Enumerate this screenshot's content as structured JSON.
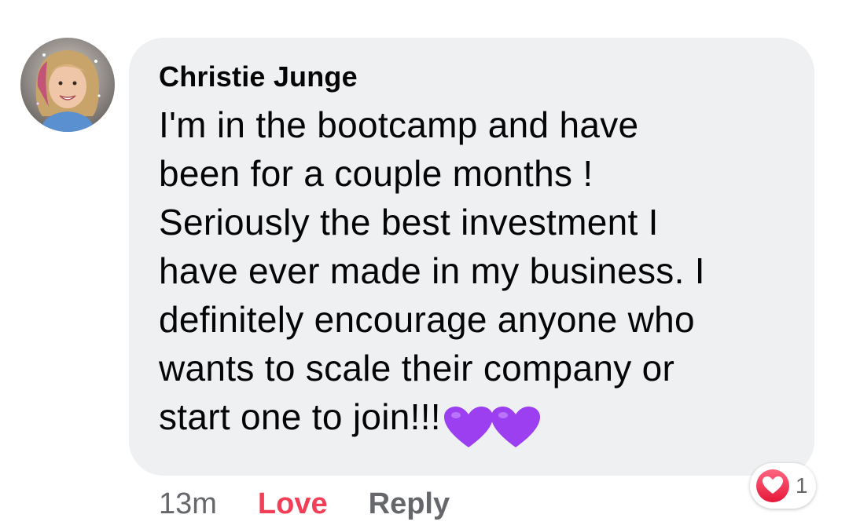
{
  "comment": {
    "author": "Christie Junge",
    "body_lines": [
      "I'm in the bootcamp and have",
      "been for a couple months !",
      "Seriously the best investment I",
      "have ever made in my business. I",
      "definitely encourage anyone who",
      "wants to scale their company or",
      "start one to join!!!"
    ],
    "emoji": [
      "purple-heart",
      "purple-heart"
    ],
    "timestamp": "13m",
    "love_label": "Love",
    "reply_label": "Reply",
    "reaction_count": "1",
    "reaction_icon": "love-reaction-icon"
  },
  "colors": {
    "bubble": "#eff0f2",
    "text": "#050505",
    "meta": "#65676b",
    "love": "#f33e58",
    "purple_heart": "#9b3ff0"
  }
}
